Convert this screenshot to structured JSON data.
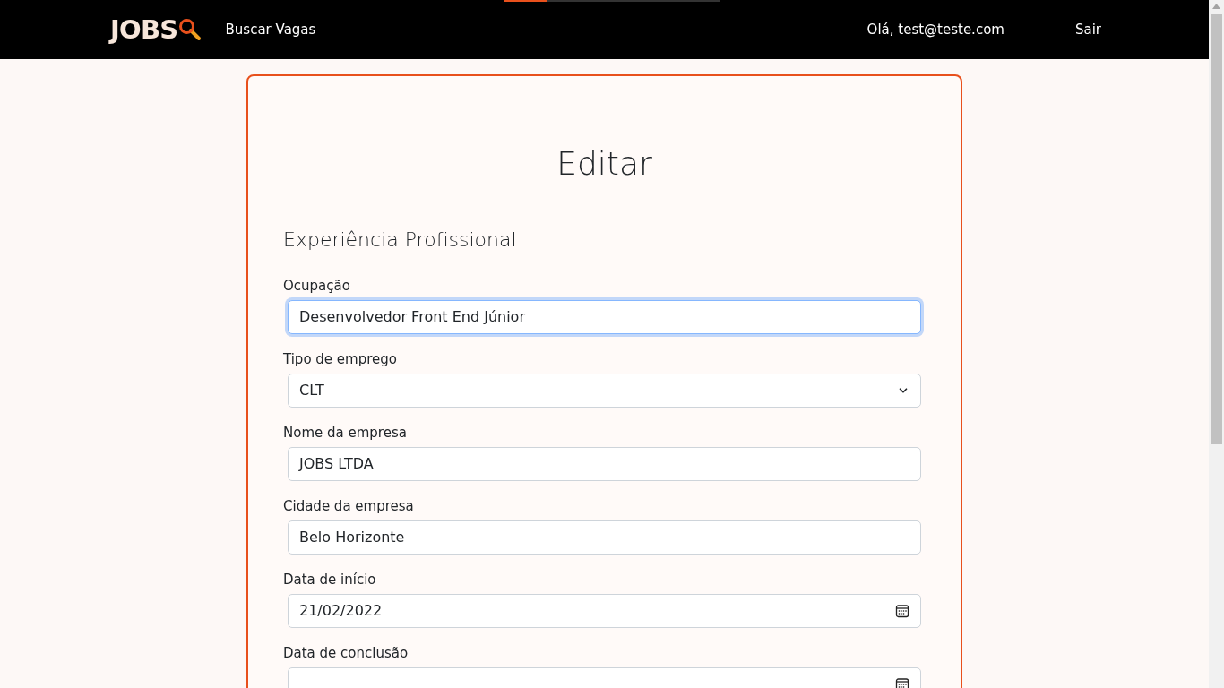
{
  "header": {
    "logo": "JOBS",
    "nav": [
      {
        "label": "Buscar Vagas"
      }
    ],
    "greeting": "Olá, test@teste.com",
    "logout": "Sair",
    "progress": {
      "level": 0.2
    }
  },
  "form": {
    "title": "Editar",
    "section": "Experiência Profissional",
    "fields": [
      {
        "kind": "text",
        "label": "Ocupação",
        "value": "Desenvolvedor Front End Júnior",
        "focused": true
      },
      {
        "kind": "select",
        "label": "Tipo de emprego",
        "value": "CLT",
        "focused": false
      },
      {
        "kind": "text",
        "label": "Nome da empresa",
        "value": "JOBS LTDA",
        "focused": false
      },
      {
        "kind": "text",
        "label": "Cidade da empresa",
        "value": "Belo Horizonte",
        "focused": false
      },
      {
        "kind": "date",
        "label": "Data de início",
        "value": "21/02/2022",
        "focused": false
      },
      {
        "kind": "date",
        "label": "Data de conclusão",
        "focused": false
      }
    ]
  }
}
